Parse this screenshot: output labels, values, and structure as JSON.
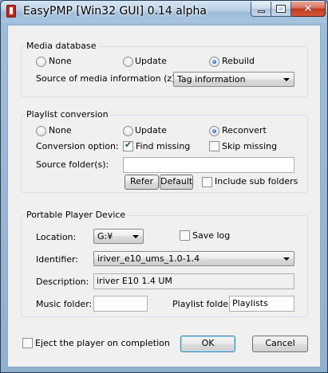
{
  "window": {
    "title": "EasyPMP [Win32 GUI] 0.14 alpha",
    "controls": {
      "minimize": "minimize-icon",
      "maximize": "maximize-icon",
      "close": "close-icon"
    }
  },
  "media_database": {
    "label": "Media database",
    "options": [
      "None",
      "Update",
      "Rebuild"
    ],
    "selected": "Rebuild",
    "source_label": "Source of media information (z):",
    "source_value": "Tag information"
  },
  "playlist_conversion": {
    "label": "Playlist conversion",
    "options": [
      "None",
      "Update",
      "Reconvert"
    ],
    "selected": "Reconvert",
    "conversion_label": "Conversion option:",
    "find_missing": {
      "label": "Find missing",
      "checked": true
    },
    "skip_missing": {
      "label": "Skip missing",
      "checked": false
    },
    "source_folders_label": "Source folder(s):",
    "source_folders_value": "",
    "refer_button": "Refer",
    "default_button": "Default",
    "include_sub": {
      "label": "Include sub folders",
      "checked": false
    }
  },
  "portable_device": {
    "label": "Portable Player Device",
    "location_label": "Location:",
    "location_value": "G:¥",
    "save_log": {
      "label": "Save log",
      "checked": false
    },
    "identifier_label": "Identifier:",
    "identifier_value": "iriver_e10_ums_1.0-1.4",
    "description_label": "Description:",
    "description_value": "iriver E10 1.4 UM",
    "music_folder_label": "Music folder:",
    "music_folder_value": "",
    "playlist_folder_label": "Playlist folder:",
    "playlist_folder_value": "Playlists"
  },
  "footer": {
    "eject": {
      "label": "Eject the player on completion",
      "checked": false
    },
    "ok_button": "OK",
    "cancel_button": "Cancel"
  },
  "colors": {
    "title_bar": "#b4cde4",
    "close_button": "#c0391e",
    "dialog_background": "#f0f0f0",
    "radio_selected": "#1b62b8"
  }
}
